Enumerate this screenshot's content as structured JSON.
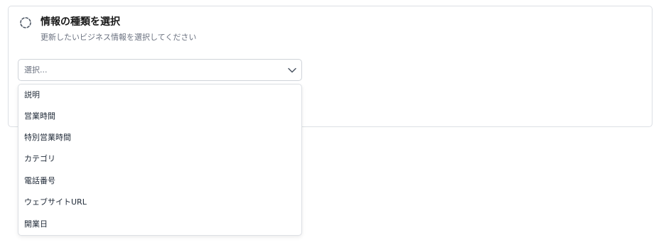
{
  "header": {
    "icon": "loading-circle-icon",
    "title": "情報の種類を選択",
    "subtitle": "更新したいビジネス情報を選択してください"
  },
  "select": {
    "placeholder": "選択...",
    "icon": "chevron-down-icon",
    "options": [
      {
        "label": "説明"
      },
      {
        "label": "営業時間"
      },
      {
        "label": "特別営業時間"
      },
      {
        "label": "カテゴリ"
      },
      {
        "label": "電話番号"
      },
      {
        "label": "ウェブサイトURL"
      },
      {
        "label": "開業日"
      }
    ]
  },
  "colors": {
    "border": "#dcdfe4",
    "text": "#1f2937",
    "muted": "#6b7280"
  }
}
